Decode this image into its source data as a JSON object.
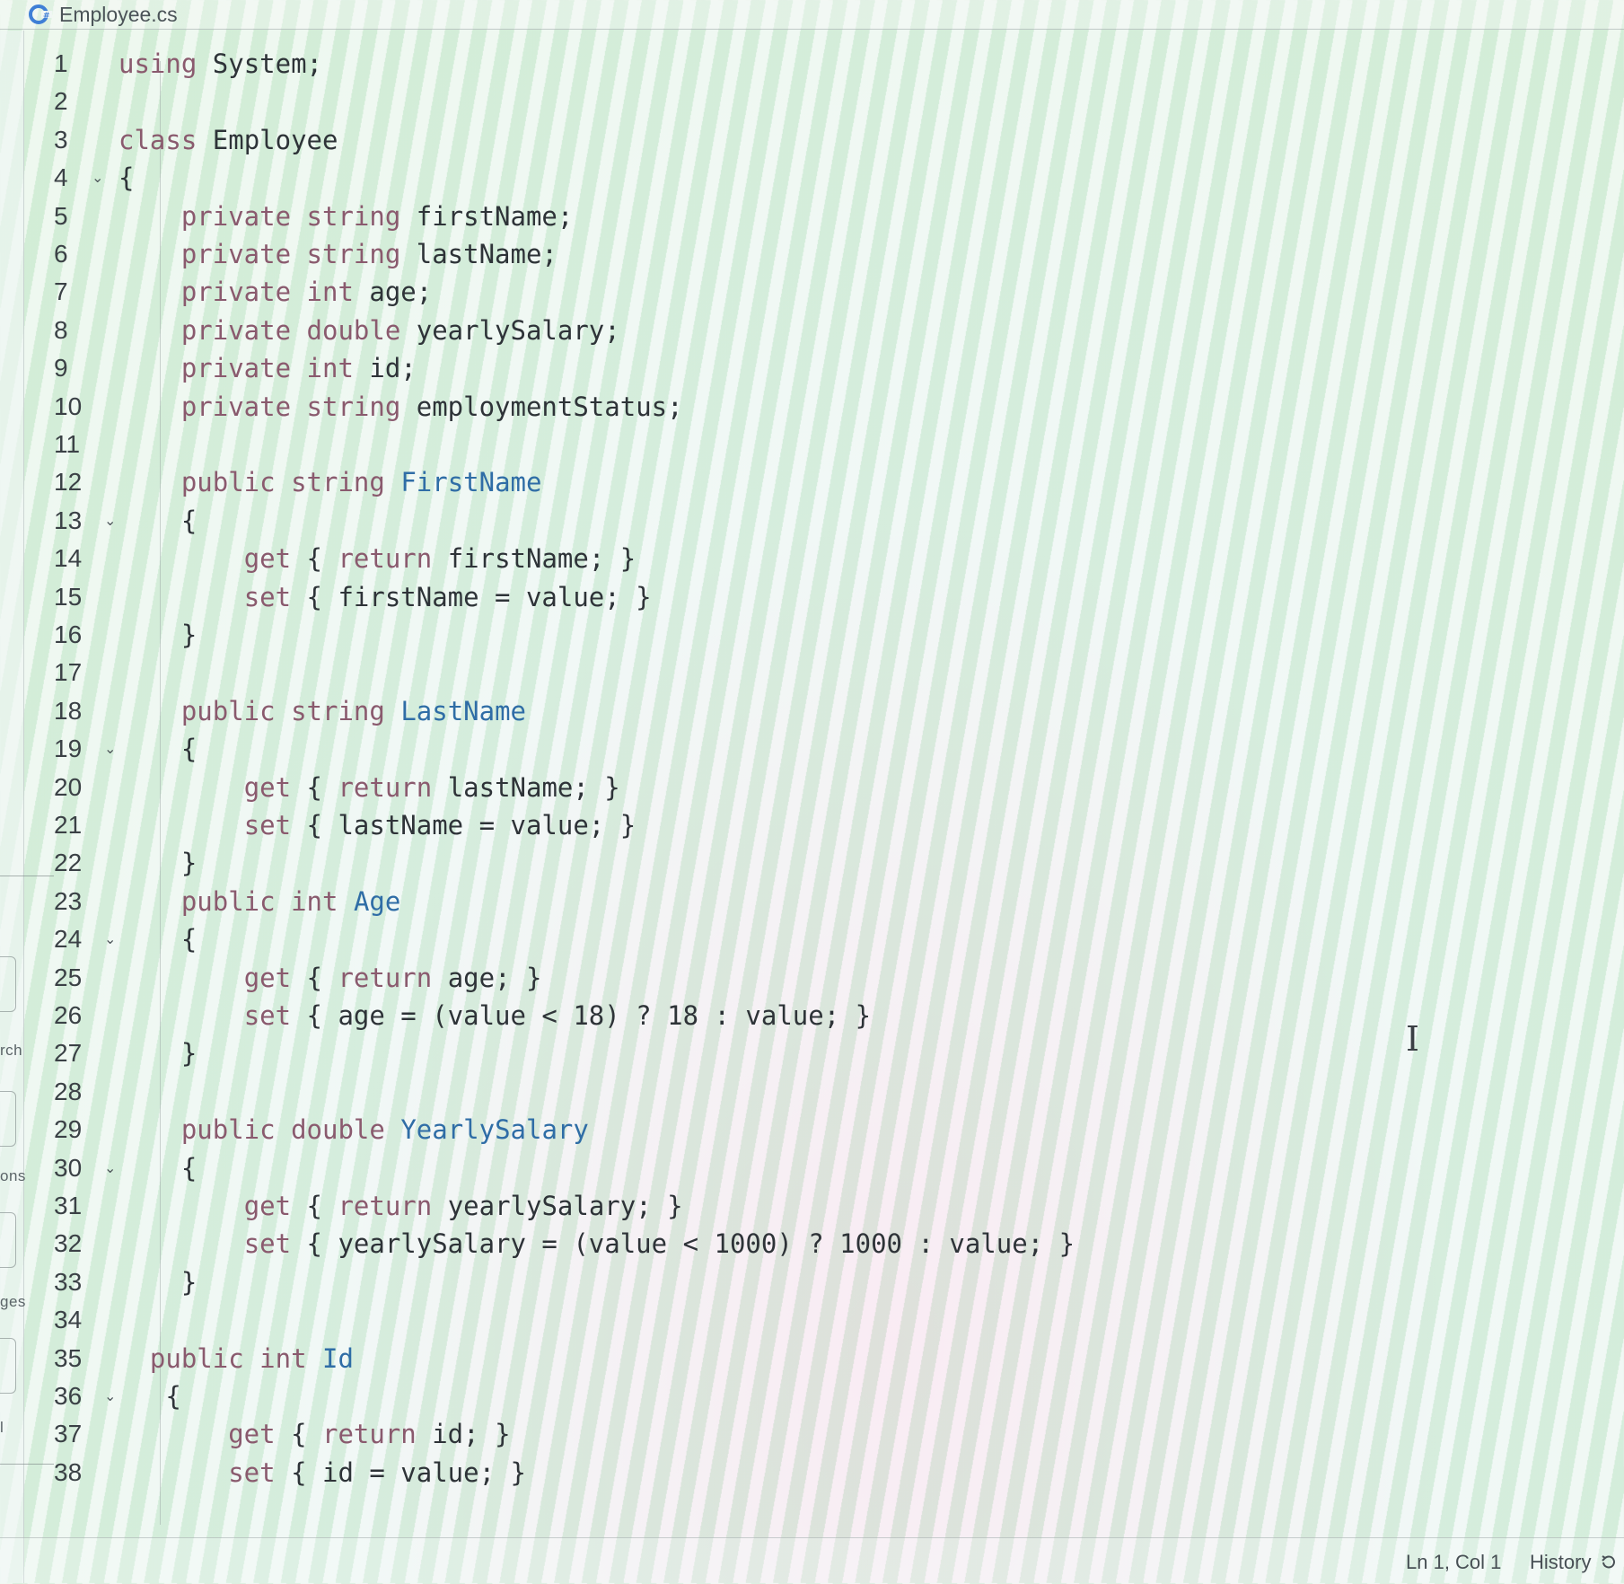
{
  "tab": {
    "file_name": "Employee.cs",
    "icon": "csharp-file-icon"
  },
  "sidebar": {
    "partial_labels": [
      "rch",
      "ons",
      "ges",
      "l"
    ]
  },
  "editor": {
    "language": "C#",
    "lines": [
      {
        "n": "1",
        "fold": false,
        "tokens": [
          [
            "kw",
            "using"
          ],
          [
            "pl",
            " System;"
          ]
        ]
      },
      {
        "n": "2",
        "fold": false,
        "tokens": []
      },
      {
        "n": "3",
        "fold": false,
        "tokens": [
          [
            "kw",
            "class"
          ],
          [
            "pl",
            " Employee"
          ]
        ]
      },
      {
        "n": "4",
        "fold": true,
        "tokens": [
          [
            "pl",
            "{"
          ]
        ]
      },
      {
        "n": "5",
        "fold": false,
        "tokens": [
          [
            "pl",
            "    "
          ],
          [
            "kw",
            "private"
          ],
          [
            "pl",
            " "
          ],
          [
            "ty",
            "string"
          ],
          [
            "pl",
            " firstName;"
          ]
        ]
      },
      {
        "n": "6",
        "fold": false,
        "tokens": [
          [
            "pl",
            "    "
          ],
          [
            "kw",
            "private"
          ],
          [
            "pl",
            " "
          ],
          [
            "ty",
            "string"
          ],
          [
            "pl",
            " lastName;"
          ]
        ]
      },
      {
        "n": "7",
        "fold": false,
        "tokens": [
          [
            "pl",
            "    "
          ],
          [
            "kw",
            "private"
          ],
          [
            "pl",
            " "
          ],
          [
            "ty",
            "int"
          ],
          [
            "pl",
            " age;"
          ]
        ]
      },
      {
        "n": "8",
        "fold": false,
        "tokens": [
          [
            "pl",
            "    "
          ],
          [
            "kw",
            "private"
          ],
          [
            "pl",
            " "
          ],
          [
            "ty",
            "double"
          ],
          [
            "pl",
            " yearlySalary;"
          ]
        ]
      },
      {
        "n": "9",
        "fold": false,
        "tokens": [
          [
            "pl",
            "    "
          ],
          [
            "kw",
            "private"
          ],
          [
            "pl",
            " "
          ],
          [
            "ty",
            "int"
          ],
          [
            "pl",
            " id;"
          ]
        ]
      },
      {
        "n": "10",
        "fold": false,
        "tokens": [
          [
            "pl",
            "    "
          ],
          [
            "kw",
            "private"
          ],
          [
            "pl",
            " "
          ],
          [
            "ty",
            "string"
          ],
          [
            "pl",
            " employmentStatus;"
          ]
        ]
      },
      {
        "n": "11",
        "fold": false,
        "tokens": []
      },
      {
        "n": "12",
        "fold": false,
        "tokens": [
          [
            "pl",
            "    "
          ],
          [
            "kw",
            "public"
          ],
          [
            "pl",
            " "
          ],
          [
            "ty",
            "string"
          ],
          [
            "pl",
            " "
          ],
          [
            "id",
            "FirstName"
          ]
        ]
      },
      {
        "n": "13",
        "fold": true,
        "tokens": [
          [
            "pl",
            "    {"
          ]
        ]
      },
      {
        "n": "14",
        "fold": false,
        "tokens": [
          [
            "pl",
            "        "
          ],
          [
            "kw",
            "get"
          ],
          [
            "pl",
            " { "
          ],
          [
            "kw",
            "return"
          ],
          [
            "pl",
            " firstName; }"
          ]
        ]
      },
      {
        "n": "15",
        "fold": false,
        "tokens": [
          [
            "pl",
            "        "
          ],
          [
            "kw",
            "set"
          ],
          [
            "pl",
            " { firstName = value; }"
          ]
        ]
      },
      {
        "n": "16",
        "fold": false,
        "tokens": [
          [
            "pl",
            "    }"
          ]
        ]
      },
      {
        "n": "17",
        "fold": false,
        "tokens": []
      },
      {
        "n": "18",
        "fold": false,
        "tokens": [
          [
            "pl",
            "    "
          ],
          [
            "kw",
            "public"
          ],
          [
            "pl",
            " "
          ],
          [
            "ty",
            "string"
          ],
          [
            "pl",
            " "
          ],
          [
            "id",
            "LastName"
          ]
        ]
      },
      {
        "n": "19",
        "fold": true,
        "tokens": [
          [
            "pl",
            "    {"
          ]
        ]
      },
      {
        "n": "20",
        "fold": false,
        "tokens": [
          [
            "pl",
            "        "
          ],
          [
            "kw",
            "get"
          ],
          [
            "pl",
            " { "
          ],
          [
            "kw",
            "return"
          ],
          [
            "pl",
            " lastName; }"
          ]
        ]
      },
      {
        "n": "21",
        "fold": false,
        "tokens": [
          [
            "pl",
            "        "
          ],
          [
            "kw",
            "set"
          ],
          [
            "pl",
            " { lastName = value; }"
          ]
        ]
      },
      {
        "n": "22",
        "fold": false,
        "tokens": [
          [
            "pl",
            "    }"
          ]
        ]
      },
      {
        "n": "23",
        "fold": false,
        "tokens": [
          [
            "pl",
            "    "
          ],
          [
            "kw",
            "public"
          ],
          [
            "pl",
            " "
          ],
          [
            "ty",
            "int"
          ],
          [
            "pl",
            " "
          ],
          [
            "id",
            "Age"
          ]
        ]
      },
      {
        "n": "24",
        "fold": true,
        "tokens": [
          [
            "pl",
            "    {"
          ]
        ]
      },
      {
        "n": "25",
        "fold": false,
        "tokens": [
          [
            "pl",
            "        "
          ],
          [
            "kw",
            "get"
          ],
          [
            "pl",
            " { "
          ],
          [
            "kw",
            "return"
          ],
          [
            "pl",
            " age; }"
          ]
        ]
      },
      {
        "n": "26",
        "fold": false,
        "tokens": [
          [
            "pl",
            "        "
          ],
          [
            "kw",
            "set"
          ],
          [
            "pl",
            " { age = (value < 18) ? 18 : value; }"
          ]
        ]
      },
      {
        "n": "27",
        "fold": false,
        "tokens": [
          [
            "pl",
            "    }"
          ]
        ]
      },
      {
        "n": "28",
        "fold": false,
        "tokens": []
      },
      {
        "n": "29",
        "fold": false,
        "tokens": [
          [
            "pl",
            "    "
          ],
          [
            "kw",
            "public"
          ],
          [
            "pl",
            " "
          ],
          [
            "ty",
            "double"
          ],
          [
            "pl",
            " "
          ],
          [
            "id",
            "YearlySalary"
          ]
        ]
      },
      {
        "n": "30",
        "fold": true,
        "tokens": [
          [
            "pl",
            "    {"
          ]
        ]
      },
      {
        "n": "31",
        "fold": false,
        "tokens": [
          [
            "pl",
            "        "
          ],
          [
            "kw",
            "get"
          ],
          [
            "pl",
            " { "
          ],
          [
            "kw",
            "return"
          ],
          [
            "pl",
            " yearlySalary; }"
          ]
        ]
      },
      {
        "n": "32",
        "fold": false,
        "tokens": [
          [
            "pl",
            "        "
          ],
          [
            "kw",
            "set"
          ],
          [
            "pl",
            " { yearlySalary = (value < 1000) ? 1000 : value; }"
          ]
        ]
      },
      {
        "n": "33",
        "fold": false,
        "tokens": [
          [
            "pl",
            "    }"
          ]
        ]
      },
      {
        "n": "34",
        "fold": false,
        "tokens": []
      },
      {
        "n": "35",
        "fold": false,
        "tokens": [
          [
            "pl",
            "  "
          ],
          [
            "kw",
            "public"
          ],
          [
            "pl",
            " "
          ],
          [
            "ty",
            "int"
          ],
          [
            "pl",
            " "
          ],
          [
            "id",
            "Id"
          ]
        ]
      },
      {
        "n": "36",
        "fold": true,
        "tokens": [
          [
            "pl",
            "   {"
          ]
        ]
      },
      {
        "n": "37",
        "fold": false,
        "tokens": [
          [
            "pl",
            "       "
          ],
          [
            "kw",
            "get"
          ],
          [
            "pl",
            " { "
          ],
          [
            "kw",
            "return"
          ],
          [
            "pl",
            " id; }"
          ]
        ]
      },
      {
        "n": "38",
        "fold": false,
        "tokens": [
          [
            "pl",
            "       "
          ],
          [
            "kw",
            "set"
          ],
          [
            "pl",
            " { id = value; }"
          ]
        ]
      }
    ]
  },
  "status": {
    "position": "Ln 1, Col 1",
    "history_label": "History",
    "history_icon": "history-icon"
  },
  "colors": {
    "keyword": "#8a5a6e",
    "identifier": "#2f6da6",
    "text": "#2e3338",
    "tab_icon": "#3f7fd6"
  }
}
